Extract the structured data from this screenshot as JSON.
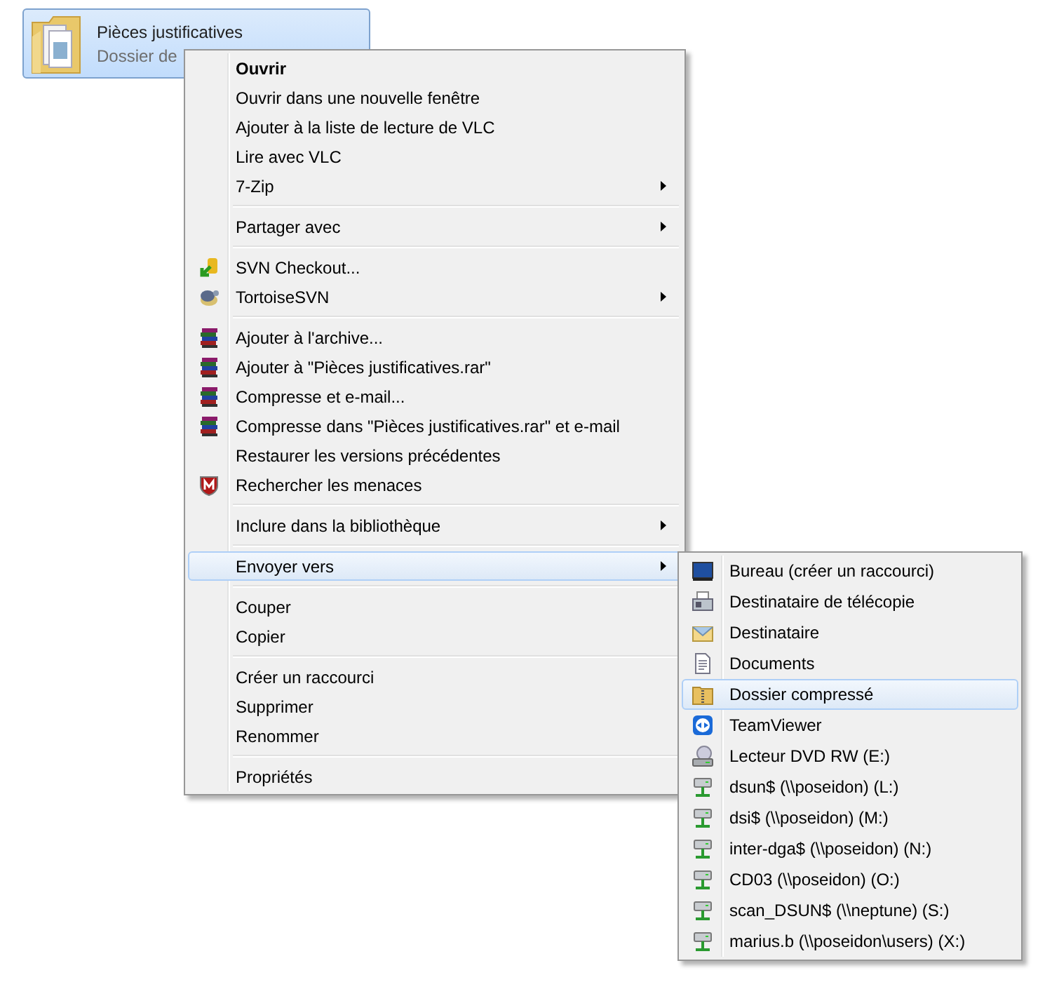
{
  "folder": {
    "name": "Pièces justificatives",
    "type": "Dossier de",
    "selected": true
  },
  "menu": [
    {
      "kind": "plain",
      "label": "Ouvrir",
      "default": true,
      "submenu": false,
      "selected": false
    },
    {
      "kind": "plain",
      "label": "Ouvrir dans une nouvelle fenêtre",
      "default": false,
      "submenu": false,
      "selected": false
    },
    {
      "kind": "plain",
      "label": "Ajouter à la liste de lecture de VLC",
      "default": false,
      "submenu": false,
      "selected": false
    },
    {
      "kind": "plain",
      "label": "Lire avec VLC",
      "default": false,
      "submenu": false,
      "selected": false
    },
    {
      "kind": "plain",
      "label": "7-Zip",
      "default": false,
      "submenu": true,
      "selected": false
    },
    {
      "kind": "separator"
    },
    {
      "kind": "plain",
      "label": "Partager avec",
      "default": false,
      "submenu": true,
      "selected": false
    },
    {
      "kind": "separator"
    },
    {
      "kind": "svn-checkout",
      "label": "SVN Checkout...",
      "default": false,
      "submenu": false,
      "selected": false
    },
    {
      "kind": "tortoise",
      "label": "TortoiseSVN",
      "default": false,
      "submenu": true,
      "selected": false
    },
    {
      "kind": "separator"
    },
    {
      "kind": "archive",
      "label": "Ajouter à l'archive...",
      "default": false,
      "submenu": false,
      "selected": false
    },
    {
      "kind": "archive",
      "label": "Ajouter à \"Pièces justificatives.rar\"",
      "default": false,
      "submenu": false,
      "selected": false
    },
    {
      "kind": "archive",
      "label": "Compresse et e-mail...",
      "default": false,
      "submenu": false,
      "selected": false
    },
    {
      "kind": "archive",
      "label": "Compresse dans \"Pièces justificatives.rar\" et e-mail",
      "default": false,
      "submenu": false,
      "selected": false
    },
    {
      "kind": "plain",
      "label": "Restaurer les versions précédentes",
      "default": false,
      "submenu": false,
      "selected": false
    },
    {
      "kind": "shield",
      "label": "Rechercher les menaces",
      "default": false,
      "submenu": false,
      "selected": false
    },
    {
      "kind": "separator"
    },
    {
      "kind": "plain",
      "label": "Inclure dans la bibliothèque",
      "default": false,
      "submenu": true,
      "selected": false
    },
    {
      "kind": "separator"
    },
    {
      "kind": "plain",
      "label": "Envoyer vers",
      "default": false,
      "submenu": true,
      "selected": true
    },
    {
      "kind": "separator"
    },
    {
      "kind": "plain",
      "label": "Couper",
      "default": false,
      "submenu": false,
      "selected": false
    },
    {
      "kind": "plain",
      "label": "Copier",
      "default": false,
      "submenu": false,
      "selected": false
    },
    {
      "kind": "separator"
    },
    {
      "kind": "plain",
      "label": "Créer un raccourci",
      "default": false,
      "submenu": false,
      "selected": false
    },
    {
      "kind": "plain",
      "label": "Supprimer",
      "default": false,
      "submenu": false,
      "selected": false
    },
    {
      "kind": "plain",
      "label": "Renommer",
      "default": false,
      "submenu": false,
      "selected": false
    },
    {
      "kind": "separator"
    },
    {
      "kind": "plain",
      "label": "Propriétés",
      "default": false,
      "submenu": false,
      "selected": false
    }
  ],
  "send_to": [
    {
      "kind": "desktop",
      "label": "Bureau (créer un raccourci)",
      "selected": false
    },
    {
      "kind": "fax",
      "label": "Destinataire de télécopie",
      "selected": false
    },
    {
      "kind": "mail",
      "label": "Destinataire",
      "selected": false
    },
    {
      "kind": "document",
      "label": "Documents",
      "selected": false
    },
    {
      "kind": "zip-folder",
      "label": "Dossier compressé",
      "selected": true
    },
    {
      "kind": "teamviewer",
      "label": "TeamViewer",
      "selected": false
    },
    {
      "kind": "dvd",
      "label": "Lecteur DVD RW (E:)",
      "selected": false
    },
    {
      "kind": "network-drive",
      "label": "dsun$ (\\\\poseidon) (L:)",
      "selected": false
    },
    {
      "kind": "network-drive",
      "label": "dsi$ (\\\\poseidon) (M:)",
      "selected": false
    },
    {
      "kind": "network-drive",
      "label": "inter-dga$ (\\\\poseidon) (N:)",
      "selected": false
    },
    {
      "kind": "network-drive",
      "label": "CD03 (\\\\poseidon) (O:)",
      "selected": false
    },
    {
      "kind": "network-drive",
      "label": "scan_DSUN$ (\\\\neptune) (S:)",
      "selected": false
    },
    {
      "kind": "network-drive",
      "label": "marius.b (\\\\poseidon\\users) (X:)",
      "selected": false
    }
  ]
}
